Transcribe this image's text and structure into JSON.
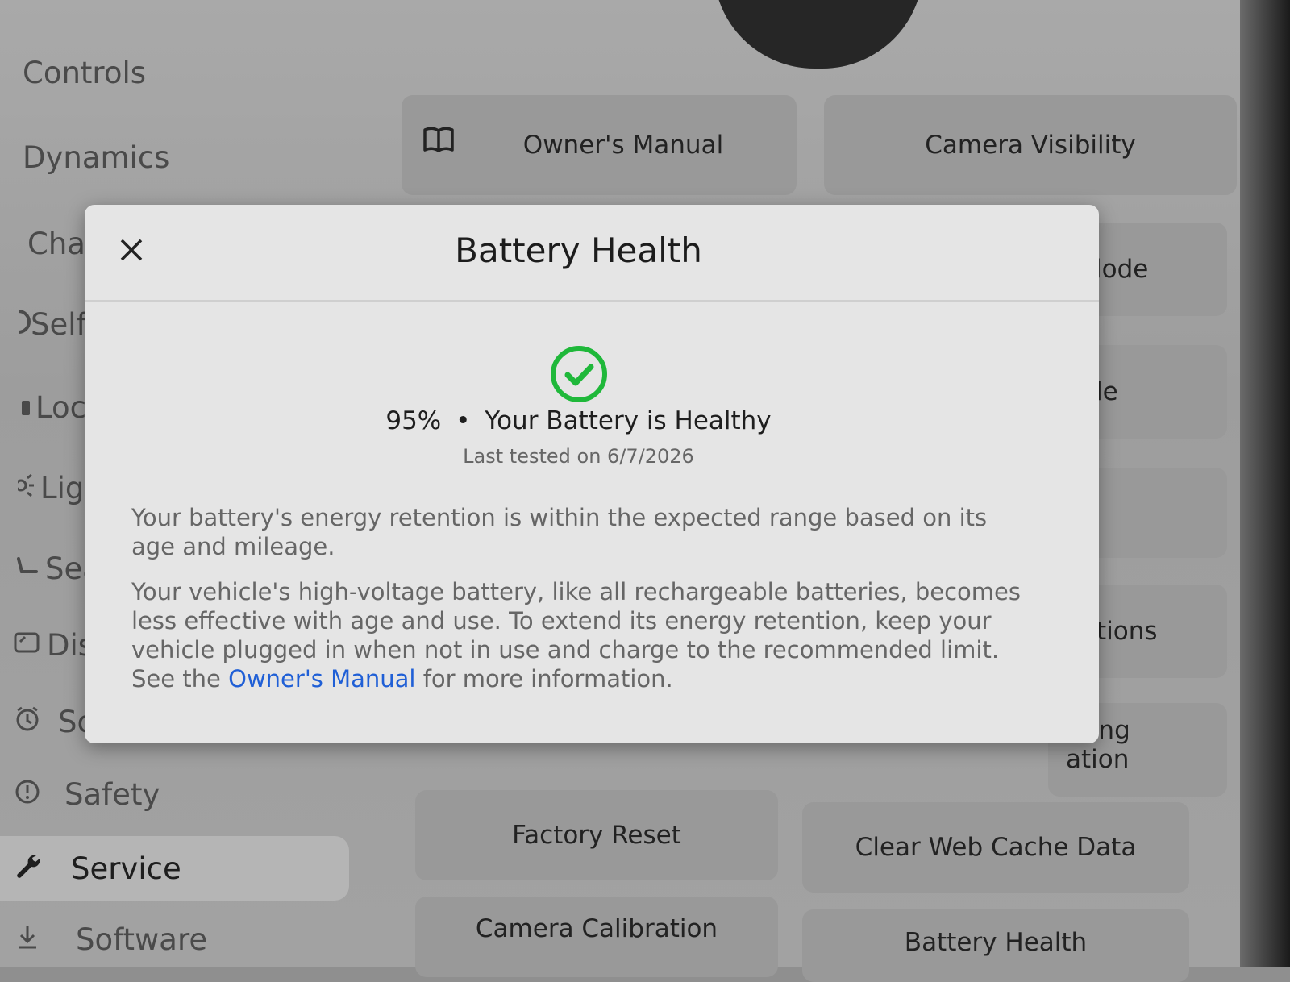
{
  "sidebar": {
    "items": [
      {
        "label": "Controls",
        "icon": "",
        "active": false
      },
      {
        "label": "Dynamics",
        "icon": "",
        "active": false
      },
      {
        "label": "Cha",
        "icon": "",
        "active": false
      },
      {
        "label": "Self",
        "icon": "steering-wheel-icon",
        "active": false
      },
      {
        "label": "Locl",
        "icon": "lock-icon",
        "active": false
      },
      {
        "label": "Ligh",
        "icon": "light-icon",
        "active": false
      },
      {
        "label": "Sea",
        "icon": "seat-icon",
        "active": false
      },
      {
        "label": "Disp",
        "icon": "display-icon",
        "active": false
      },
      {
        "label": "Sch",
        "icon": "alarm-clock-icon",
        "active": false
      },
      {
        "label": "Safety",
        "icon": "info-circle-icon",
        "active": false
      },
      {
        "label": "Service",
        "icon": "wrench-icon",
        "active": true
      },
      {
        "label": "Software",
        "icon": "download-icon",
        "active": false
      }
    ]
  },
  "tiles": {
    "owners_manual": "Owner's Manual",
    "camera_visibility": "Camera Visibility",
    "mode_fragment": "lode",
    "de_fragment": "de",
    "ations_fragment": "cations",
    "ering_fragment": "ering",
    "ation_fragment": "ation",
    "factory_reset": "Factory Reset",
    "clear_web_cache": "Clear Web Cache Data",
    "camera_calibration": "Camera Calibration",
    "battery_health": "Battery Health"
  },
  "modal": {
    "title": "Battery Health",
    "percent": "95%",
    "separator": "•",
    "status": "Your Battery is Healthy",
    "last_tested": "Last tested on 6/7/2026",
    "paragraph1": "Your battery's energy retention is within the expected range based on its age and mileage.",
    "paragraph2_before_link": "Your vehicle's high-voltage battery, like all rechargeable batteries, becomes less effective with age and use. To extend its energy retention, keep your vehicle plugged in when not in use and charge to the recommended limit. See the ",
    "paragraph2_link": "Owner's Manual",
    "paragraph2_after_link": " for more information.",
    "status_color": "#1fb83a",
    "link_color": "#1f5fd6"
  }
}
